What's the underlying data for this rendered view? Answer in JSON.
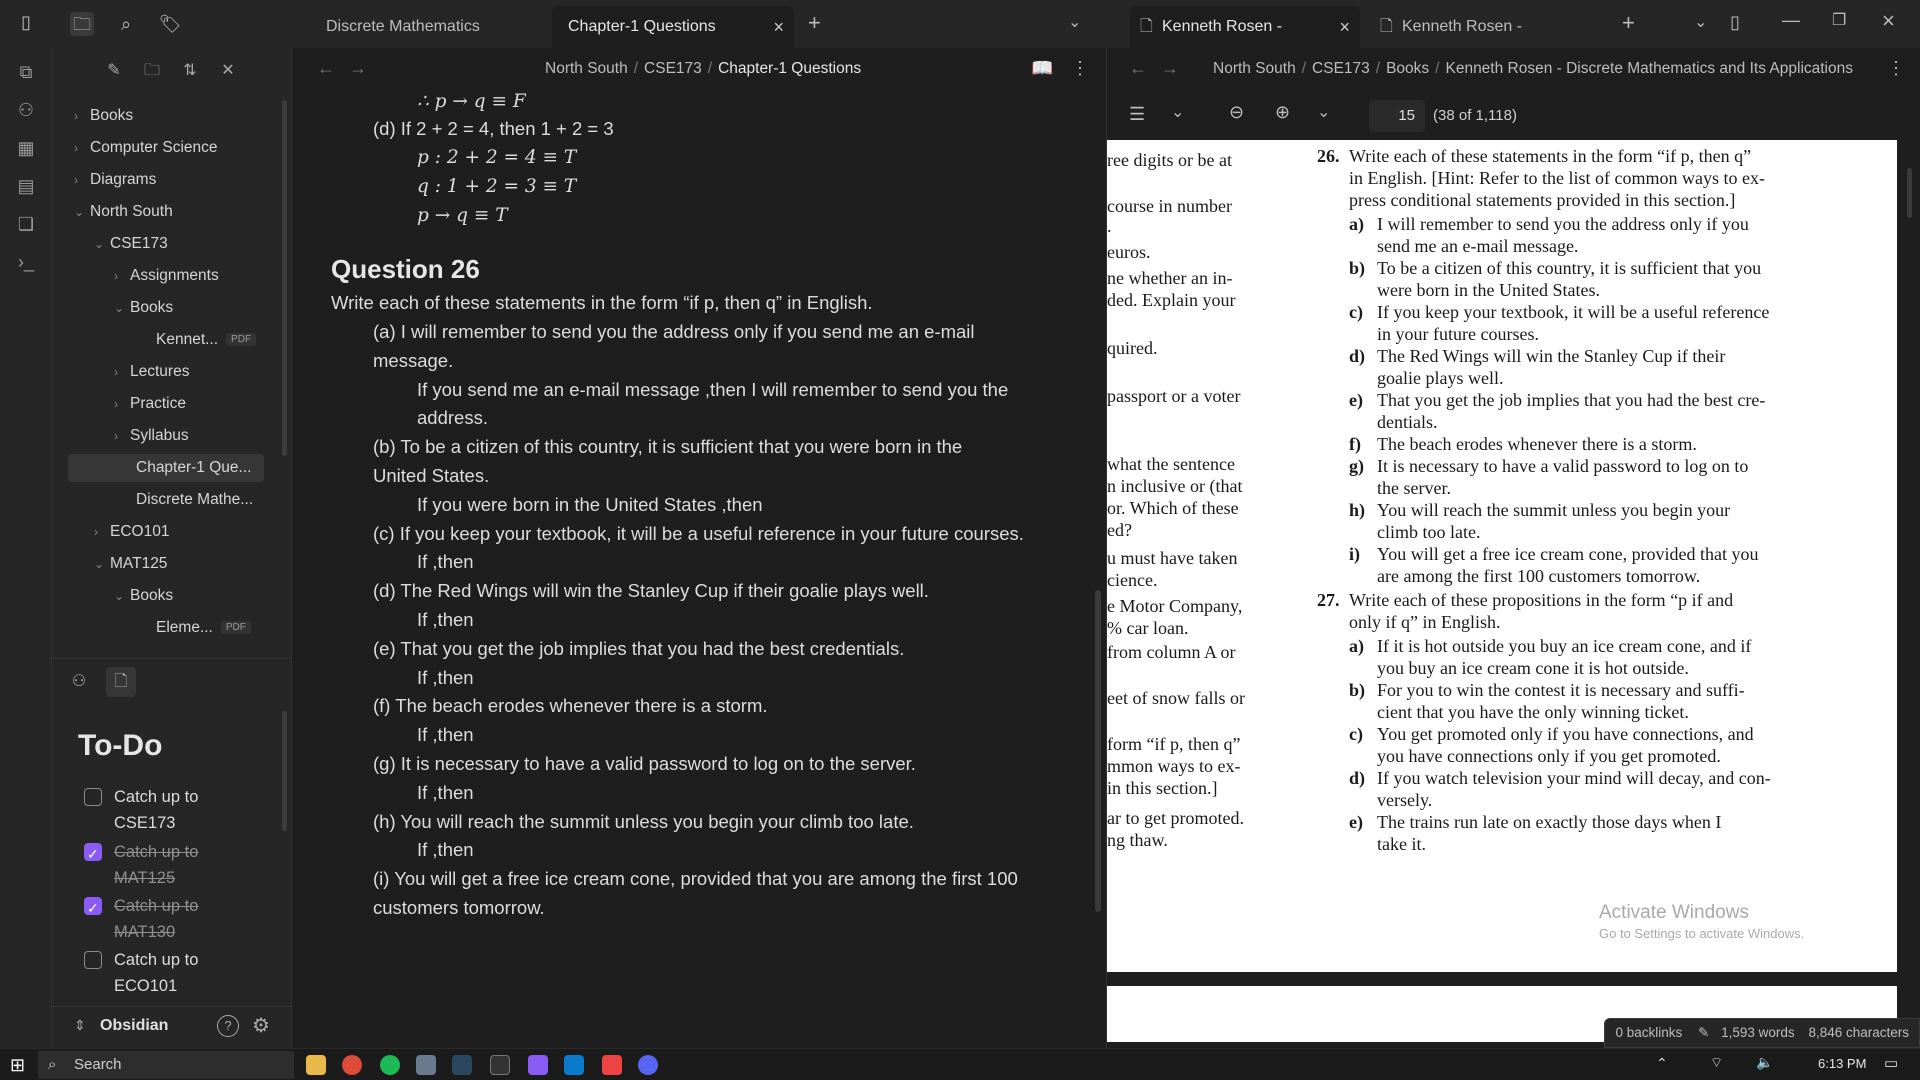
{
  "tabs": {
    "left_tab_1": "Discrete Mathematics",
    "left_tab_2": "Chapter-1 Questions",
    "right_tab_1": "Kenneth Rosen - Discre...",
    "right_tab_2": "Kenneth Rosen - Discrete ..."
  },
  "explorer": {
    "items": [
      {
        "label": "Books"
      },
      {
        "label": "Computer Science"
      },
      {
        "label": "Diagrams"
      },
      {
        "label": "North South"
      },
      {
        "label": "CSE173"
      },
      {
        "label": "Assignments"
      },
      {
        "label": "Books"
      },
      {
        "label": "Kennet...",
        "badge": "PDF"
      },
      {
        "label": "Lectures"
      },
      {
        "label": "Practice"
      },
      {
        "label": "Syllabus"
      },
      {
        "label": "Chapter-1 Que..."
      },
      {
        "label": "Discrete Mathe..."
      },
      {
        "label": "ECO101"
      },
      {
        "label": "MAT125"
      },
      {
        "label": "Books"
      },
      {
        "label": "Eleme...",
        "badge": "PDF"
      }
    ]
  },
  "todo": {
    "title": "To-Do",
    "items": [
      {
        "text": "Catch up to CSE173",
        "done": false
      },
      {
        "text": "Catch up to MAT125",
        "done": true
      },
      {
        "text": "Catch up to MAT130",
        "done": true
      },
      {
        "text": "Catch up to ECO101",
        "done": false
      }
    ]
  },
  "vault": {
    "name": "Obsidian"
  },
  "note": {
    "breadcrumb": [
      "North South",
      "CSE173",
      "Chapter-1 Questions"
    ],
    "top_lines": [
      "∴ p → q ≡ F",
      "(d) If 2 + 2 = 4, then 1 + 2 = 3",
      "p : 2 + 2 = 4 ≡ T",
      "q : 1 + 2 = 3 ≡ T",
      "p → q ≡ T"
    ],
    "heading": "Question 26",
    "intro": "Write each of these statements in the form “if p, then q” in English.",
    "body_lines": [
      "(a) I will remember to send you the address only if you send me an e-mail",
      "message.",
      "If you send me an e-mail message ,then I will remember to send you the",
      "address.",
      "(b) To be a citizen of this country, it is sufficient that you were born in the",
      "United States.",
      "If you were born in the United States ,then",
      "(c) If you keep your textbook, it will be a useful reference in your future courses.",
      "If ,then",
      "(d) The Red Wings will win the Stanley Cup if their goalie plays well.",
      "If ,then",
      "(e) That you get the job implies that you had the best credentials.",
      "If ,then",
      "(f) The beach erodes whenever there is a storm.",
      "If ,then",
      "(g) It is necessary to have a valid password to log on to the server.",
      "If ,then",
      "(h) You will reach the summit unless you begin your climb too late.",
      "If ,then",
      "(i) You will get a free ice cream cone, provided that you are among the first 100",
      "customers tomorrow."
    ]
  },
  "pdf": {
    "breadcrumb": [
      "North South",
      "CSE173",
      "Books",
      "Kenneth Rosen - Discrete Mathematics and Its Applications"
    ],
    "page_input": "15",
    "page_info": "(38 of 1,118)",
    "left_col": [
      "ree digits or be at",
      "course in number",
      ".",
      "euros.",
      "ne whether an in-",
      "ded. Explain your",
      "quired.",
      "passport or a voter",
      "what the sentence",
      "n inclusive or (that",
      "or. Which of these",
      "ed?",
      "u must have taken",
      "cience.",
      "e Motor Company,",
      "% car loan.",
      "from column A or",
      "eet of snow falls or",
      "form “if p, then q”",
      "mmon ways to ex-",
      "in this section.]",
      "ar to get promoted.",
      "ng thaw."
    ],
    "q26_num": "26.",
    "q26_lines": [
      "Write each of these statements in the form “if p, then q”",
      "in English. [Hint: Refer to the list of common ways to ex-",
      "press conditional statements provided in this section.]"
    ],
    "q26_items": [
      {
        "l": "a)",
        "t": [
          "I will remember to send you the address only if you",
          "send me an e-mail message."
        ]
      },
      {
        "l": "b)",
        "t": [
          "To be a citizen of this country, it is sufficient that you",
          "were born in the United States."
        ]
      },
      {
        "l": "c)",
        "t": [
          "If you keep your textbook, it will be a useful reference",
          "in your future courses."
        ]
      },
      {
        "l": "d)",
        "t": [
          "The Red Wings will win the Stanley Cup if their",
          "goalie plays well."
        ]
      },
      {
        "l": "e)",
        "t": [
          "That you get the job implies that you had the best cre-",
          "dentials."
        ]
      },
      {
        "l": "f)",
        "t": [
          "The beach erodes whenever there is a storm."
        ]
      },
      {
        "l": "g)",
        "t": [
          "It is necessary to have a valid password to log on to",
          "the server."
        ]
      },
      {
        "l": "h)",
        "t": [
          "You will reach the summit unless you begin your",
          "climb too late."
        ]
      },
      {
        "l": "i)",
        "t": [
          "You will get a free ice cream cone, provided that you",
          "are among the first 100 customers tomorrow."
        ]
      }
    ],
    "q27_num": "27.",
    "q27_lines": [
      "Write each of these propositions in the form “p if and",
      "only if q” in English."
    ],
    "q27_items": [
      {
        "l": "a)",
        "t": [
          "If it is hot outside you buy an ice cream cone, and if",
          "you buy an ice cream cone it is hot outside."
        ]
      },
      {
        "l": "b)",
        "t": [
          "For you to win the contest it is necessary and suffi-",
          "cient that you have the only winning ticket."
        ]
      },
      {
        "l": "c)",
        "t": [
          "You get promoted only if you have connections, and",
          "you have connections only if you get promoted."
        ]
      },
      {
        "l": "d)",
        "t": [
          "If you watch television your mind will decay, and con-",
          "versely."
        ]
      },
      {
        "l": "e)",
        "t": [
          "The trains run late on exactly those days when I",
          "take it."
        ]
      }
    ],
    "watermark_1": "Activate Windows",
    "watermark_2": "Go to Settings to activate Windows."
  },
  "status": {
    "backlinks": "0 backlinks",
    "words": "1,593 words",
    "chars": "8,846 characters"
  },
  "taskbar": {
    "search": "Search",
    "time": "6:13 PM"
  },
  "colors": {
    "accent": "#8a5cf5",
    "bg_main": "#1e1e1e",
    "bg_side": "#262626"
  }
}
